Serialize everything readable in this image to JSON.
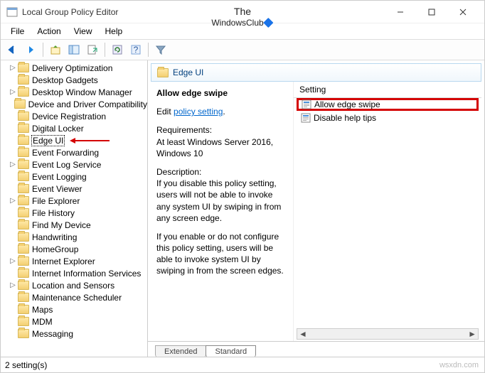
{
  "window": {
    "title": "Local Group Policy Editor"
  },
  "logo": {
    "line1": "The",
    "line2": "WindowsClub"
  },
  "menu": [
    "File",
    "Action",
    "View",
    "Help"
  ],
  "tree": {
    "items": [
      {
        "label": "Delivery Optimization",
        "exp": "▷"
      },
      {
        "label": "Desktop Gadgets",
        "exp": ""
      },
      {
        "label": "Desktop Window Manager",
        "exp": "▷"
      },
      {
        "label": "Device and Driver Compatibility",
        "exp": ""
      },
      {
        "label": "Device Registration",
        "exp": ""
      },
      {
        "label": "Digital Locker",
        "exp": ""
      },
      {
        "label": "Edge UI",
        "exp": "",
        "selected": true,
        "arrow": true
      },
      {
        "label": "Event Forwarding",
        "exp": ""
      },
      {
        "label": "Event Log Service",
        "exp": "▷"
      },
      {
        "label": "Event Logging",
        "exp": ""
      },
      {
        "label": "Event Viewer",
        "exp": ""
      },
      {
        "label": "File Explorer",
        "exp": "▷"
      },
      {
        "label": "File History",
        "exp": ""
      },
      {
        "label": "Find My Device",
        "exp": ""
      },
      {
        "label": "Handwriting",
        "exp": ""
      },
      {
        "label": "HomeGroup",
        "exp": ""
      },
      {
        "label": "Internet Explorer",
        "exp": "▷"
      },
      {
        "label": "Internet Information Services",
        "exp": ""
      },
      {
        "label": "Location and Sensors",
        "exp": "▷"
      },
      {
        "label": "Maintenance Scheduler",
        "exp": ""
      },
      {
        "label": "Maps",
        "exp": ""
      },
      {
        "label": "MDM",
        "exp": ""
      },
      {
        "label": "Messaging",
        "exp": ""
      }
    ]
  },
  "right": {
    "header": "Edge UI",
    "desc": {
      "title": "Allow edge swipe",
      "edit_prefix": "Edit ",
      "edit_link": "policy setting",
      "req_label": "Requirements:",
      "req_text": "At least Windows Server 2016, Windows 10",
      "desc_label": "Description:",
      "desc_text1": "If you disable this policy setting, users will not be able to invoke any system UI by swiping in from any screen edge.",
      "desc_text2": "If you enable or do not configure this policy setting, users will be able to invoke system UI by swiping in from the screen edges."
    },
    "settings": {
      "col": "Setting",
      "items": [
        {
          "label": "Allow edge swipe",
          "highlight": true,
          "icon": "policy"
        },
        {
          "label": "Disable help tips",
          "highlight": false,
          "icon": "policy"
        }
      ]
    }
  },
  "tabs": {
    "extended": "Extended",
    "standard": "Standard"
  },
  "status": "2 setting(s)",
  "watermark": "wsxdn.com"
}
